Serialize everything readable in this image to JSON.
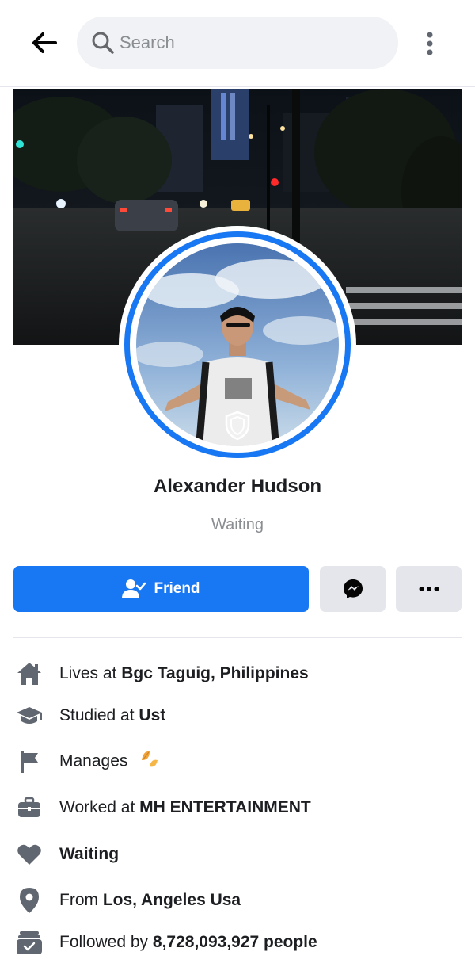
{
  "search": {
    "placeholder": "Search"
  },
  "profile": {
    "name": "Alexander Hudson",
    "status": "Waiting"
  },
  "actions": {
    "friend_label": "Friend"
  },
  "details": [
    {
      "prefix": "Lives at ",
      "value": "Bgc Taguig, Philippines",
      "icon": "home-icon"
    },
    {
      "prefix": "Studied at ",
      "value": "Ust",
      "icon": "graduation-cap-icon"
    },
    {
      "prefix": "Manages ",
      "value": "",
      "icon": "flag-icon"
    },
    {
      "prefix": "Worked at ",
      "value": "MH ENTERTAINMENT",
      "icon": "briefcase-icon"
    },
    {
      "prefix": "",
      "value": "Waiting",
      "icon": "heart-icon"
    },
    {
      "prefix": "From ",
      "value": "Los, Angeles Usa",
      "icon": "location-pin-icon"
    },
    {
      "prefix": "Followed by ",
      "value": "8,728,093,927 people",
      "icon": "followers-icon"
    }
  ],
  "colors": {
    "accent": "#1877f2",
    "icon_gray": "#8a8d91",
    "button_gray": "#e4e6eb"
  }
}
